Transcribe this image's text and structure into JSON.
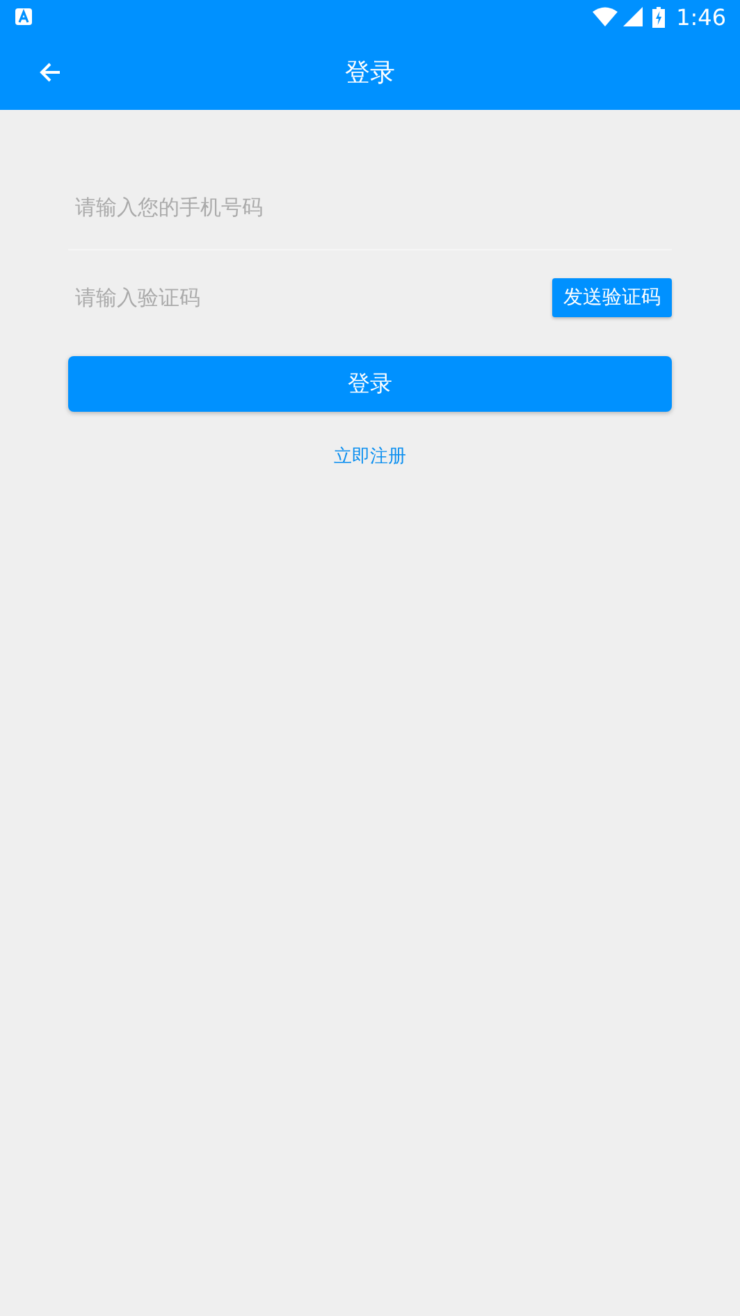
{
  "status_bar": {
    "time": "1:46"
  },
  "app_bar": {
    "title": "登录"
  },
  "phone_field": {
    "placeholder": "请输入您的手机号码"
  },
  "code_field": {
    "placeholder": "请输入验证码"
  },
  "send_code_button": {
    "label": "发送验证码"
  },
  "login_button": {
    "label": "登录"
  },
  "register_link": {
    "label": "立即注册"
  }
}
